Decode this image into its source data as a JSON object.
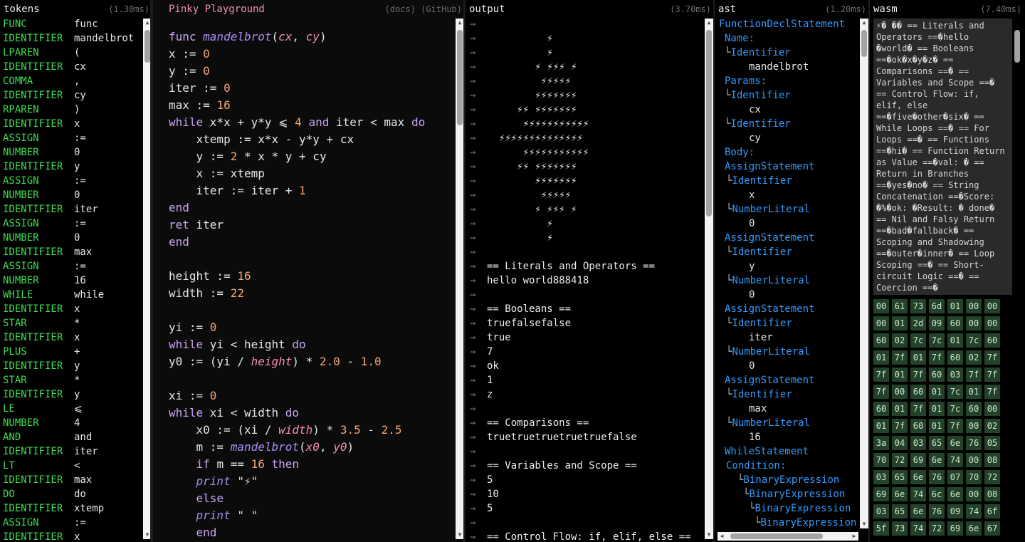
{
  "tokens": {
    "title": "tokens",
    "timing": "(1.30ms)",
    "rows": [
      [
        "FUNC",
        "func"
      ],
      [
        "IDENTIFIER",
        "mandelbrot"
      ],
      [
        "LPAREN",
        "("
      ],
      [
        "IDENTIFIER",
        "cx"
      ],
      [
        "COMMA",
        ","
      ],
      [
        "IDENTIFIER",
        "cy"
      ],
      [
        "RPAREN",
        ")"
      ],
      [
        "IDENTIFIER",
        "x"
      ],
      [
        "ASSIGN",
        ":="
      ],
      [
        "NUMBER",
        "0"
      ],
      [
        "IDENTIFIER",
        "y"
      ],
      [
        "ASSIGN",
        ":="
      ],
      [
        "NUMBER",
        "0"
      ],
      [
        "IDENTIFIER",
        "iter"
      ],
      [
        "ASSIGN",
        ":="
      ],
      [
        "NUMBER",
        "0"
      ],
      [
        "IDENTIFIER",
        "max"
      ],
      [
        "ASSIGN",
        ":="
      ],
      [
        "NUMBER",
        "16"
      ],
      [
        "WHILE",
        "while"
      ],
      [
        "IDENTIFIER",
        "x"
      ],
      [
        "STAR",
        "*"
      ],
      [
        "IDENTIFIER",
        "x"
      ],
      [
        "PLUS",
        "+"
      ],
      [
        "IDENTIFIER",
        "y"
      ],
      [
        "STAR",
        "*"
      ],
      [
        "IDENTIFIER",
        "y"
      ],
      [
        "LE",
        "⩽"
      ],
      [
        "NUMBER",
        "4"
      ],
      [
        "AND",
        "and"
      ],
      [
        "IDENTIFIER",
        "iter"
      ],
      [
        "LT",
        "<"
      ],
      [
        "IDENTIFIER",
        "max"
      ],
      [
        "DO",
        "do"
      ],
      [
        "IDENTIFIER",
        "xtemp"
      ],
      [
        "ASSIGN",
        ":="
      ],
      [
        "IDENTIFIER",
        "x"
      ]
    ]
  },
  "editor": {
    "title": "Pinky Playground",
    "links": "(docs) (GitHub)",
    "lines": [
      [
        [
          "kw",
          "func "
        ],
        [
          "fn",
          "mandelbrot"
        ],
        [
          "t",
          "("
        ],
        [
          "pa",
          "cx"
        ],
        [
          "t",
          ", "
        ],
        [
          "pa",
          "cy"
        ],
        [
          "t",
          ")"
        ]
      ],
      [
        [
          "t",
          "x := "
        ],
        [
          "num",
          "0"
        ]
      ],
      [
        [
          "t",
          "y := "
        ],
        [
          "num",
          "0"
        ]
      ],
      [
        [
          "t",
          "iter := "
        ],
        [
          "num",
          "0"
        ]
      ],
      [
        [
          "t",
          "max := "
        ],
        [
          "num",
          "16"
        ]
      ],
      [
        [
          "kw",
          "while "
        ],
        [
          "t",
          "x*x + y*y ⩽ "
        ],
        [
          "num",
          "4"
        ],
        [
          "kw",
          " and "
        ],
        [
          "t",
          "iter < max "
        ],
        [
          "kw",
          "do"
        ]
      ],
      [
        [
          "t",
          "    xtemp := x*x - y*y + cx"
        ]
      ],
      [
        [
          "t",
          "    y := "
        ],
        [
          "num",
          "2"
        ],
        [
          "t",
          " * x * y + cy"
        ]
      ],
      [
        [
          "t",
          "    x := xtemp"
        ]
      ],
      [
        [
          "t",
          "    iter := iter + "
        ],
        [
          "num",
          "1"
        ]
      ],
      [
        [
          "kw",
          "end"
        ]
      ],
      [
        [
          "kw",
          "ret "
        ],
        [
          "t",
          "iter"
        ]
      ],
      [
        [
          "kw",
          "end"
        ]
      ],
      [],
      [
        [
          "t",
          "height := "
        ],
        [
          "num",
          "16"
        ]
      ],
      [
        [
          "t",
          "width := "
        ],
        [
          "num",
          "22"
        ]
      ],
      [],
      [
        [
          "t",
          "yi := "
        ],
        [
          "num",
          "0"
        ]
      ],
      [
        [
          "kw",
          "while "
        ],
        [
          "t",
          "yi < height "
        ],
        [
          "kw",
          "do"
        ]
      ],
      [
        [
          "t",
          "y0 := (yi / "
        ],
        [
          "pa",
          "height"
        ],
        [
          "t",
          ") * "
        ],
        [
          "num",
          "2.0"
        ],
        [
          "t",
          " - "
        ],
        [
          "num",
          "1.0"
        ]
      ],
      [],
      [
        [
          "t",
          "xi := "
        ],
        [
          "num",
          "0"
        ]
      ],
      [
        [
          "kw",
          "while "
        ],
        [
          "t",
          "xi < width "
        ],
        [
          "kw",
          "do"
        ]
      ],
      [
        [
          "t",
          "    x0 := (xi / "
        ],
        [
          "pa",
          "width"
        ],
        [
          "t",
          ") * "
        ],
        [
          "num",
          "3.5"
        ],
        [
          "t",
          " - "
        ],
        [
          "num",
          "2.5"
        ]
      ],
      [
        [
          "t",
          "    m := "
        ],
        [
          "fn",
          "mandelbrot"
        ],
        [
          "t",
          "("
        ],
        [
          "pa",
          "x0"
        ],
        [
          "t",
          ", "
        ],
        [
          "pa",
          "y0"
        ],
        [
          "t",
          ")"
        ]
      ],
      [
        [
          "t",
          "    "
        ],
        [
          "kw",
          "if "
        ],
        [
          "t",
          "m == "
        ],
        [
          "num",
          "16"
        ],
        [
          "kw",
          " then"
        ]
      ],
      [
        [
          "t",
          "    "
        ],
        [
          "fn",
          "print "
        ],
        [
          "str",
          "\"⚡\""
        ]
      ],
      [
        [
          "t",
          "    "
        ],
        [
          "kw",
          "else"
        ]
      ],
      [
        [
          "t",
          "    "
        ],
        [
          "fn",
          "print "
        ],
        [
          "str",
          "\" \""
        ]
      ],
      [
        [
          "t",
          "    "
        ],
        [
          "kw",
          "end"
        ]
      ]
    ]
  },
  "output": {
    "title": "output",
    "timing": "(3.70ms)",
    "prompt": "⇝",
    "lines": [
      "",
      "          ⚡",
      "          ⚡",
      "        ⚡ ⚡⚡⚡ ⚡",
      "         ⚡⚡⚡⚡⚡",
      "        ⚡⚡⚡⚡⚡⚡⚡",
      "     ⚡⚡ ⚡⚡⚡⚡⚡⚡⚡",
      "      ⚡⚡⚡⚡⚡⚡⚡⚡⚡⚡⚡",
      "  ⚡⚡⚡⚡⚡⚡⚡⚡⚡⚡⚡⚡⚡⚡",
      "      ⚡⚡⚡⚡⚡⚡⚡⚡⚡⚡⚡",
      "     ⚡⚡ ⚡⚡⚡⚡⚡⚡⚡",
      "        ⚡⚡⚡⚡⚡⚡⚡",
      "         ⚡⚡⚡⚡⚡",
      "        ⚡ ⚡⚡⚡ ⚡",
      "          ⚡",
      "          ⚡",
      "",
      "== Literals and Operators ==",
      "hello world888418",
      "",
      "== Booleans ==",
      "truefalsefalse",
      "true",
      "7",
      "ok",
      "1",
      "z",
      "",
      "== Comparisons ==",
      "truetruetruetruetruefalse",
      "",
      "== Variables and Scope ==",
      "5",
      "10",
      "5",
      "",
      "== Control Flow: if, elif, else =="
    ]
  },
  "ast": {
    "title": "ast",
    "timing": "(1.20ms)",
    "rows": [
      [
        0,
        "node",
        "",
        "FunctionDeclStatement"
      ],
      [
        1,
        "label",
        "",
        "Name:"
      ],
      [
        1,
        "node",
        "└",
        "Identifier"
      ],
      [
        5,
        "leaf",
        "",
        "mandelbrot"
      ],
      [
        1,
        "label",
        "",
        "Params:"
      ],
      [
        1,
        "node",
        "└",
        "Identifier"
      ],
      [
        5,
        "leaf",
        "",
        "cx"
      ],
      [
        1,
        "node",
        "└",
        "Identifier"
      ],
      [
        5,
        "leaf",
        "",
        "cy"
      ],
      [
        1,
        "label",
        "",
        "Body:"
      ],
      [
        1,
        "node",
        "",
        "AssignStatement"
      ],
      [
        2,
        "node",
        "└",
        "Identifier"
      ],
      [
        5,
        "leaf",
        "",
        "x"
      ],
      [
        2,
        "node",
        "└",
        "NumberLiteral"
      ],
      [
        5,
        "leaf",
        "",
        "0"
      ],
      [
        1,
        "node",
        "",
        "AssignStatement"
      ],
      [
        2,
        "node",
        "└",
        "Identifier"
      ],
      [
        5,
        "leaf",
        "",
        "y"
      ],
      [
        2,
        "node",
        "└",
        "NumberLiteral"
      ],
      [
        5,
        "leaf",
        "",
        "0"
      ],
      [
        1,
        "node",
        "",
        "AssignStatement"
      ],
      [
        2,
        "node",
        "└",
        "Identifier"
      ],
      [
        5,
        "leaf",
        "",
        "iter"
      ],
      [
        2,
        "node",
        "└",
        "NumberLiteral"
      ],
      [
        5,
        "leaf",
        "",
        "0"
      ],
      [
        1,
        "node",
        "",
        "AssignStatement"
      ],
      [
        2,
        "node",
        "└",
        "Identifier"
      ],
      [
        5,
        "leaf",
        "",
        "max"
      ],
      [
        2,
        "node",
        "└",
        "NumberLiteral"
      ],
      [
        5,
        "leaf",
        "",
        "16"
      ],
      [
        1,
        "node",
        "",
        "WhileStatement"
      ],
      [
        2,
        "label",
        "",
        "Condition:"
      ],
      [
        3,
        "node",
        "└",
        "BinaryExpression"
      ],
      [
        4,
        "node",
        "└",
        "BinaryExpression"
      ],
      [
        5,
        "node",
        "└",
        "BinaryExpression"
      ],
      [
        6,
        "node",
        "└",
        "BinaryExpression"
      ]
    ]
  },
  "wasm": {
    "title": "wasm",
    "timing": "(7.40ms)",
    "text": "⚡� �� == Literals and Operators ==�hello �world� == Booleans ==�ok�x�y�z� == Comparisons ==� == Variables and Scope ==� == Control Flow: if, elif, else ==�five�other�six� == While Loops ==� == For Loops ==� == Functions ==�hi� == Function Return as Value ==�val: � == Return in Branches ==�yes�no� == String Concatenation ==�Score: �%�ok: �Result: � done� == Nil and Falsy Return ==�bad�fallback� == Scoping and Shadowing ==�outer�inner� == Loop Scoping ==� == Short-circuit Logic ==� == Coercion ==�",
    "hex": [
      "00",
      "61",
      "73",
      "6d",
      "01",
      "00",
      "00",
      "00",
      "01",
      "2d",
      "09",
      "60",
      "00",
      "00",
      "60",
      "02",
      "7c",
      "7c",
      "01",
      "7c",
      "60",
      "01",
      "7f",
      "01",
      "7f",
      "60",
      "02",
      "7f",
      "7f",
      "01",
      "7f",
      "60",
      "03",
      "7f",
      "7f",
      "7f",
      "00",
      "60",
      "01",
      "7c",
      "01",
      "7f",
      "60",
      "01",
      "7f",
      "01",
      "7c",
      "60",
      "00",
      "01",
      "7f",
      "60",
      "01",
      "7f",
      "00",
      "02",
      "3a",
      "04",
      "03",
      "65",
      "6e",
      "76",
      "05",
      "70",
      "72",
      "69",
      "6e",
      "74",
      "00",
      "08",
      "03",
      "65",
      "6e",
      "76",
      "07",
      "70",
      "72",
      "69",
      "6e",
      "74",
      "6c",
      "6e",
      "00",
      "08",
      "03",
      "65",
      "6e",
      "76",
      "09",
      "74",
      "6f",
      "5f",
      "73",
      "74",
      "72",
      "69",
      "6e",
      "67"
    ]
  }
}
